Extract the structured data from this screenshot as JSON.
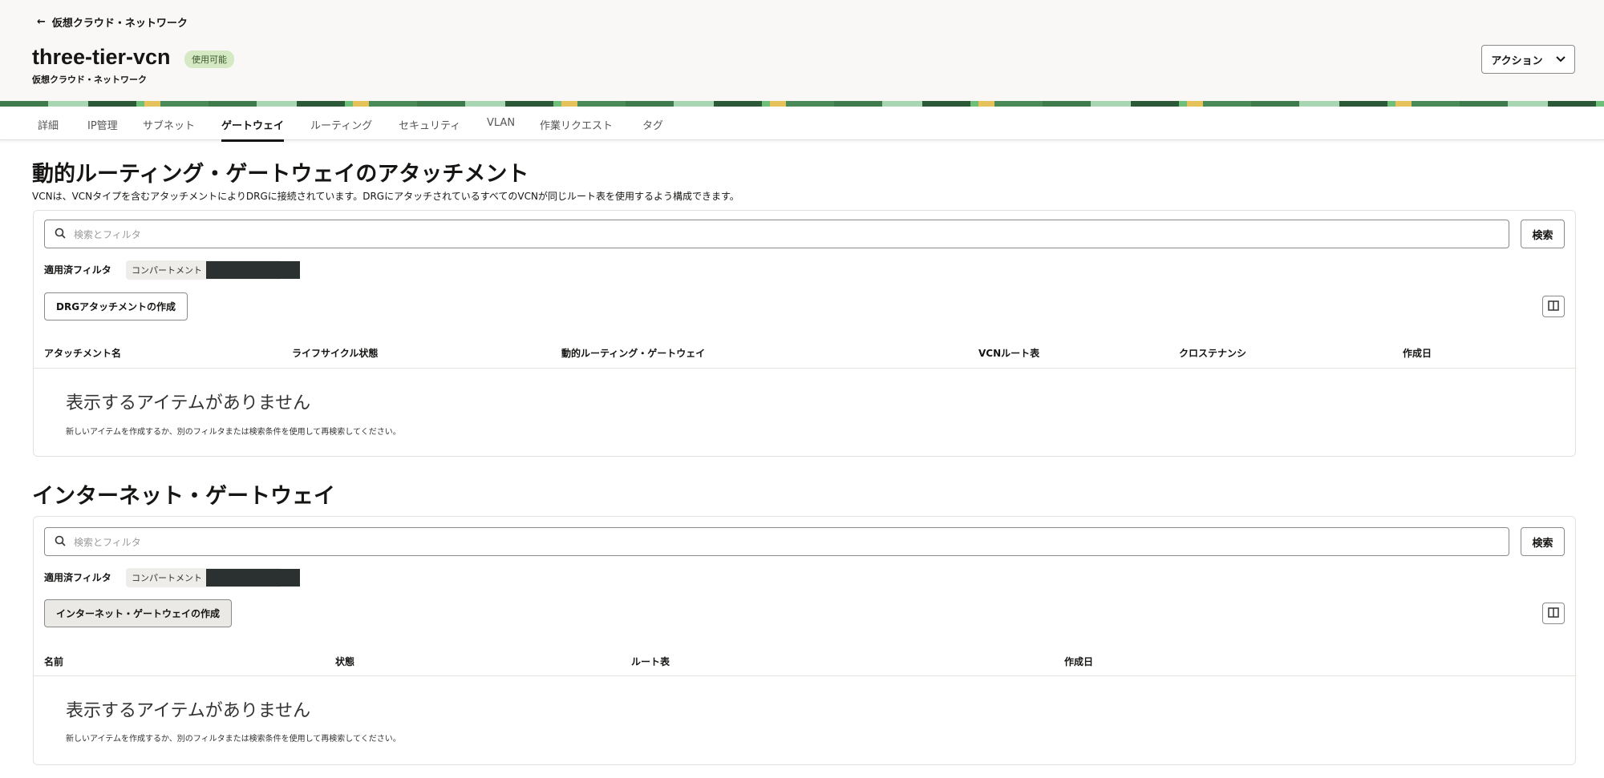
{
  "header": {
    "back_label": "仮想クラウド・ネットワーク",
    "title": "three-tier-vcn",
    "status": "使用可能",
    "subtitle": "仮想クラウド・ネットワーク",
    "actions_label": "アクション"
  },
  "tabs": [
    "詳細",
    "IP管理",
    "サブネット",
    "ゲートウェイ",
    "ルーティング",
    "セキュリティ",
    "VLAN",
    "作業リクエスト",
    "タグ"
  ],
  "drg": {
    "heading": "動的ルーティング・ゲートウェイのアタッチメント",
    "description": "VCNは、VCNタイプを含むアタッチメントによりDRGに接続されています。DRGにアタッチされているすべてのVCNが同じルート表を使用するよう構成できます。",
    "search_placeholder": "検索とフィルタ",
    "search_button": "検索",
    "applied_filter_label": "適用済フィルタ",
    "filter_chip": "コンパートメント",
    "create_button": "DRGアタッチメントの作成",
    "columns": [
      "アタッチメント名",
      "ライフサイクル状態",
      "動的ルーティング・ゲートウェイ",
      "VCNルート表",
      "クロステナンシ",
      "作成日"
    ],
    "empty_title": "表示するアイテムがありません",
    "empty_desc": "新しいアイテムを作成するか、別のフィルタまたは検索条件を使用して再検索してください。"
  },
  "igw": {
    "heading": "インターネット・ゲートウェイ",
    "search_placeholder": "検索とフィルタ",
    "search_button": "検索",
    "applied_filter_label": "適用済フィルタ",
    "filter_chip": "コンパートメント",
    "create_button": "インターネット・ゲートウェイの作成",
    "columns": [
      "名前",
      "状態",
      "ルート表",
      "作成日"
    ],
    "empty_title": "表示するアイテムがありません",
    "empty_desc": "新しいアイテムを作成するか、別のフィルタまたは検索条件を使用して再検索してください。"
  }
}
